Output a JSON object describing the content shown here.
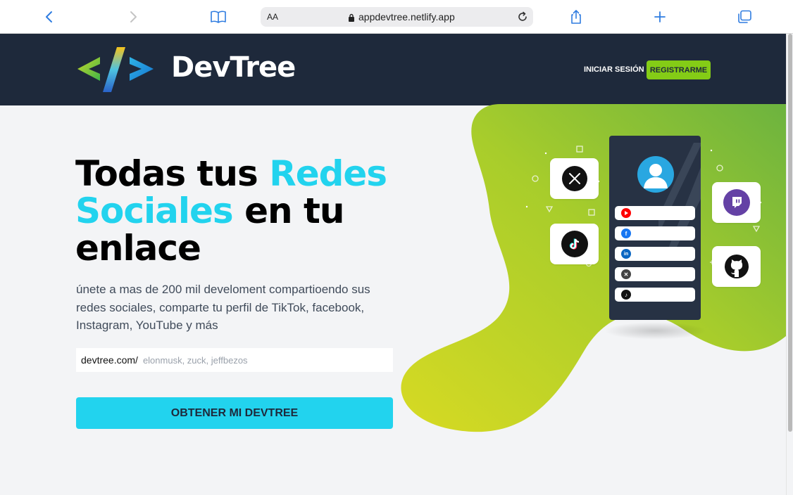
{
  "browser": {
    "text_size_label": "AA",
    "url": "appdevtree.netlify.app"
  },
  "header": {
    "logo_text": "DevTree",
    "login_label": "INICIAR SESIÓN",
    "register_label": "REGISTRARME"
  },
  "hero": {
    "title_part1": "Todas tus ",
    "title_accent": "Redes Sociales",
    "title_part2": " en tu enlace",
    "subtitle": "únete a mas de 200 mil develoment compartioendo sus redes sociales, comparte tu perfil de TikTok, facebook, Instagram, YouTube y más",
    "handle_prefix": "devtree.com/",
    "handle_placeholder": "elonmusk, zuck, jeffbezos",
    "cta_label": "OBTENER MI DEVTREE"
  },
  "illustration": {
    "phone_links": [
      {
        "icon": "youtube-icon",
        "color": "#ff0000"
      },
      {
        "icon": "facebook-icon",
        "color": "#1877f2"
      },
      {
        "icon": "linkedin-icon",
        "color": "#0a66c2"
      },
      {
        "icon": "x-icon",
        "color": "#222222"
      },
      {
        "icon": "tiktok-icon",
        "color": "#111111"
      }
    ],
    "bubbles": [
      {
        "icon": "x-icon",
        "color": "#111111"
      },
      {
        "icon": "tiktok-icon",
        "color": "#111111"
      },
      {
        "icon": "twitch-icon",
        "color": "#6441a5"
      },
      {
        "icon": "github-icon",
        "color": "#111111"
      }
    ]
  },
  "colors": {
    "header_bg": "#1e293b",
    "accent_cyan": "#22d3ee",
    "accent_green": "#84cc16"
  }
}
